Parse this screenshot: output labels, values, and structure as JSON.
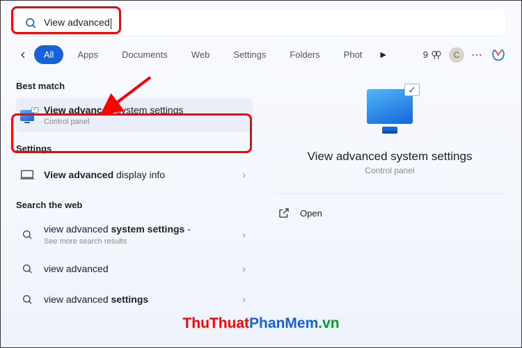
{
  "search": {
    "query": "View advanced"
  },
  "filters": {
    "all": "All",
    "apps": "Apps",
    "documents": "Documents",
    "web": "Web",
    "settings": "Settings",
    "folders": "Folders",
    "photos_truncated": "Phot"
  },
  "header_right": {
    "rewards_count": "9",
    "avatar_initial": "C"
  },
  "sections": {
    "best_match": "Best match",
    "settings": "Settings",
    "search_web": "Search the web"
  },
  "results": {
    "best": {
      "title_bold": "View advanced",
      "title_rest": " system settings",
      "subtitle": "Control panel"
    },
    "setting1": {
      "title_bold": "View advanced",
      "title_rest": " display info"
    },
    "web1": {
      "pre": "view advanced ",
      "bold": "system settings",
      "post": " -",
      "sub": "See more search results"
    },
    "web2": {
      "text": "view advanced"
    },
    "web3": {
      "pre": "view advanced ",
      "bold": "settings"
    }
  },
  "preview": {
    "title": "View advanced system settings",
    "subtitle": "Control panel",
    "open": "Open"
  },
  "watermark": {
    "a": "ThuThuat",
    "b": "PhanMem",
    "c": ".vn"
  }
}
